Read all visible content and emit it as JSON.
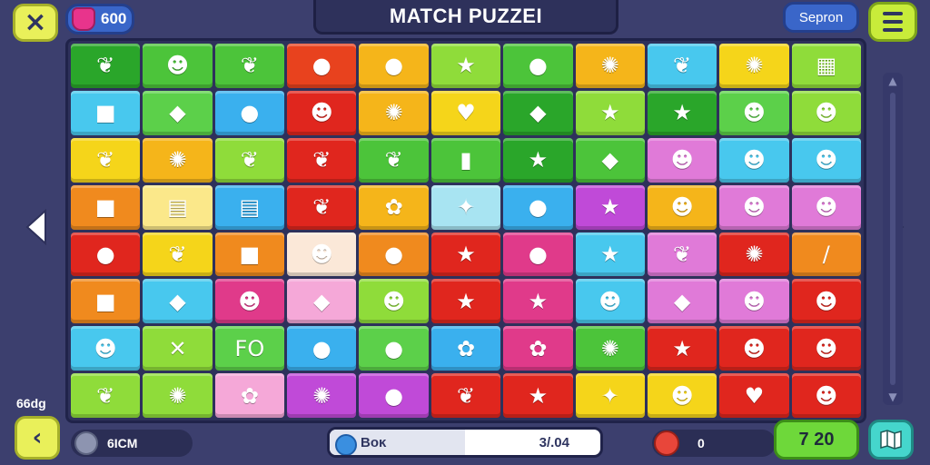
{
  "header": {
    "close_icon": "×",
    "gems_count": "600",
    "title": "MATCH PUZZEI",
    "search_label": "Sepron",
    "menu_icon": "hamburger-menu"
  },
  "side": {
    "left_label": "66dg",
    "back_icon": "‹"
  },
  "footer": {
    "left_text": "6ICM",
    "progress_label": "Boĸ",
    "progress_value": "3/.04",
    "progress_fraction": 0.5,
    "counter_value": "0",
    "score": "7 20"
  },
  "colors": {
    "background": "#3c3f6e",
    "board": "#2e315b",
    "accent_yellow": "#e9f05a",
    "accent_green": "#6ed83a",
    "accent_blue": "#3a66c9"
  },
  "board": {
    "rows": 8,
    "cols": 11,
    "tiles": [
      [
        {
          "c": "#2aa62a",
          "g": "❦"
        },
        {
          "c": "#4cc43a",
          "g": "☻"
        },
        {
          "c": "#4cc43a",
          "g": "❦"
        },
        {
          "c": "#e8421e",
          "g": "●"
        },
        {
          "c": "#f5b51a",
          "g": "●"
        },
        {
          "c": "#8fdc3a",
          "g": "★"
        },
        {
          "c": "#4cc43a",
          "g": "●"
        },
        {
          "c": "#f5b51a",
          "g": "✺"
        },
        {
          "c": "#48c8ee",
          "g": "❦"
        },
        {
          "c": "#f5d51a",
          "g": "✺"
        },
        {
          "c": "#8fdc3a",
          "g": "▦"
        },
        {
          "c": "#3ab0ee",
          "g": "▲"
        }
      ],
      [
        {
          "c": "#48c8ee",
          "g": "■"
        },
        {
          "c": "#5cd04a",
          "g": "◆"
        },
        {
          "c": "#3ab0ee",
          "g": "●"
        },
        {
          "c": "#e0261e",
          "g": "☻"
        },
        {
          "c": "#f5b51a",
          "g": "✺"
        },
        {
          "c": "#f5d51a",
          "g": "♥"
        },
        {
          "c": "#2aa62a",
          "g": "◆"
        },
        {
          "c": "#8fdc3a",
          "g": "★"
        },
        {
          "c": "#2aa62a",
          "g": "★"
        },
        {
          "c": "#5cd04a",
          "g": "☻"
        },
        {
          "c": "#8fdc3a",
          "g": "☻"
        },
        {
          "c": "#48c8ee",
          "g": "✦"
        }
      ],
      [
        {
          "c": "#f5d51a",
          "g": "❦"
        },
        {
          "c": "#f5b51a",
          "g": "✺"
        },
        {
          "c": "#8fdc3a",
          "g": "❦"
        },
        {
          "c": "#e0261e",
          "g": "❦"
        },
        {
          "c": "#4cc43a",
          "g": "❦"
        },
        {
          "c": "#4cc43a",
          "g": "▮"
        },
        {
          "c": "#2aa62a",
          "g": "★"
        },
        {
          "c": "#4cc43a",
          "g": "◆"
        },
        {
          "c": "#e07ad8",
          "g": "☻"
        },
        {
          "c": "#48c8ee",
          "g": "☻"
        },
        {
          "c": "#48c8ee",
          "g": "☻"
        },
        {
          "c": "#e03a8a",
          "g": "☻"
        }
      ],
      [
        {
          "c": "#f08a1e",
          "g": "■"
        },
        {
          "c": "#fbe88a",
          "g": "▤"
        },
        {
          "c": "#3ab0ee",
          "g": "▤"
        },
        {
          "c": "#e0261e",
          "g": "❦"
        },
        {
          "c": "#f5b51a",
          "g": "✿"
        },
        {
          "c": "#a8e4f2",
          "g": "✦"
        },
        {
          "c": "#3ab0ee",
          "g": "●"
        },
        {
          "c": "#c04ad8",
          "g": "★"
        },
        {
          "c": "#f5b51a",
          "g": "☻"
        },
        {
          "c": "#e07ad8",
          "g": "☻"
        },
        {
          "c": "#e07ad8",
          "g": "☻"
        },
        {
          "c": "#f08a1e",
          "g": "☻"
        }
      ],
      [
        {
          "c": "#e0261e",
          "g": "●"
        },
        {
          "c": "#f5d51a",
          "g": "❦"
        },
        {
          "c": "#f08a1e",
          "g": "■"
        },
        {
          "c": "#fbe8d8",
          "g": "☻"
        },
        {
          "c": "#f08a1e",
          "g": "●"
        },
        {
          "c": "#e0261e",
          "g": "★"
        },
        {
          "c": "#e03a8a",
          "g": "●"
        },
        {
          "c": "#48c8ee",
          "g": "★"
        },
        {
          "c": "#e07ad8",
          "g": "❦"
        },
        {
          "c": "#e0261e",
          "g": "✺"
        },
        {
          "c": "#f08a1e",
          "g": "/"
        },
        {
          "c": "#e0261e",
          "g": "☻"
        }
      ],
      [
        {
          "c": "#f08a1e",
          "g": "■"
        },
        {
          "c": "#48c8ee",
          "g": "◆"
        },
        {
          "c": "#e03a8a",
          "g": "☻"
        },
        {
          "c": "#f5a8d8",
          "g": "◆"
        },
        {
          "c": "#8fdc3a",
          "g": "☻"
        },
        {
          "c": "#e0261e",
          "g": "★"
        },
        {
          "c": "#e03a8a",
          "g": "★"
        },
        {
          "c": "#48c8ee",
          "g": "☻"
        },
        {
          "c": "#e07ad8",
          "g": "◆"
        },
        {
          "c": "#e07ad8",
          "g": "☻"
        },
        {
          "c": "#e0261e",
          "g": "☻"
        },
        {
          "c": "#e03a8a",
          "g": "☻"
        }
      ],
      [
        {
          "c": "#48c8ee",
          "g": "☻"
        },
        {
          "c": "#8fdc3a",
          "g": "✕"
        },
        {
          "c": "#5cd04a",
          "g": "FO"
        },
        {
          "c": "#3ab0ee",
          "g": "●"
        },
        {
          "c": "#5cd04a",
          "g": "●"
        },
        {
          "c": "#3ab0ee",
          "g": "✿"
        },
        {
          "c": "#e03a8a",
          "g": "✿"
        },
        {
          "c": "#4cc43a",
          "g": "✺"
        },
        {
          "c": "#e0261e",
          "g": "★"
        },
        {
          "c": "#e0261e",
          "g": "☻"
        },
        {
          "c": "#e0261e",
          "g": "☻"
        },
        {
          "c": "#e07ad8",
          "g": "☻"
        }
      ],
      [
        {
          "c": "#8fdc3a",
          "g": "❦"
        },
        {
          "c": "#8fdc3a",
          "g": "✺"
        },
        {
          "c": "#f5a8d8",
          "g": "✿"
        },
        {
          "c": "#c04ad8",
          "g": "✺"
        },
        {
          "c": "#c04ad8",
          "g": "●"
        },
        {
          "c": "#e0261e",
          "g": "❦"
        },
        {
          "c": "#e0261e",
          "g": "★"
        },
        {
          "c": "#f5d51a",
          "g": "✦"
        },
        {
          "c": "#f5d51a",
          "g": "☻"
        },
        {
          "c": "#e0261e",
          "g": "♥"
        },
        {
          "c": "#e0261e",
          "g": "☻"
        },
        {
          "c": "#e0261e",
          "g": "★"
        }
      ]
    ]
  }
}
